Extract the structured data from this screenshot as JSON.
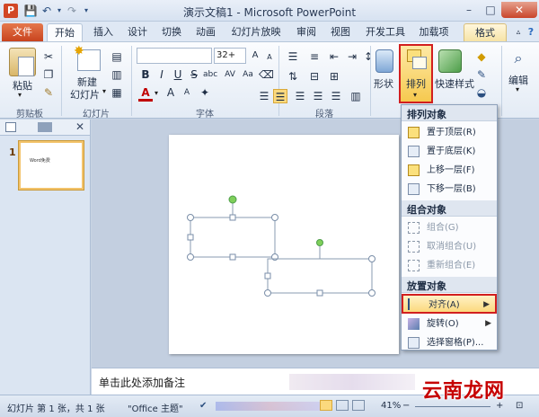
{
  "window": {
    "title": "演示文稿1 - Microsoft PowerPoint",
    "app_icon_letter": "P"
  },
  "tabs": [
    {
      "label": "文件"
    },
    {
      "label": "开始"
    },
    {
      "label": "插入"
    },
    {
      "label": "设计"
    },
    {
      "label": "切换"
    },
    {
      "label": "动画"
    },
    {
      "label": "幻灯片放映"
    },
    {
      "label": "审阅"
    },
    {
      "label": "视图"
    },
    {
      "label": "开发工具"
    },
    {
      "label": "加载项"
    },
    {
      "label": "格式"
    }
  ],
  "ribbon": {
    "clipboard": {
      "paste_label": "粘贴",
      "group_label": "剪贴板"
    },
    "slides": {
      "new_slide_label": "新建",
      "new_slide_label2": "幻灯片",
      "group_label": "幻灯片"
    },
    "font": {
      "size_value": "32+",
      "group_label": "字体"
    },
    "paragraph": {
      "group_label": "段落"
    },
    "drawing": {
      "shape_label": "形状",
      "arrange_label": "排列",
      "quickstyle_label": "快速样式"
    },
    "editing": {
      "edit_label": "编辑"
    }
  },
  "left_pane": {
    "slide_number": "1",
    "thumb_text": "Word免费"
  },
  "notes": {
    "placeholder": "单击此处添加备注"
  },
  "status": {
    "slide_info": "幻灯片 第 1 张，共 1 张",
    "theme": "\"Office 主题\"",
    "zoom": "41%"
  },
  "watermark": "云南龙网",
  "arrange_menu": {
    "section_order": "排列对象",
    "items_order": [
      {
        "label": "置于顶层(R)"
      },
      {
        "label": "置于底层(K)"
      },
      {
        "label": "上移一层(F)"
      },
      {
        "label": "下移一层(B)"
      }
    ],
    "section_group": "组合对象",
    "items_group": [
      {
        "label": "组合(G)"
      },
      {
        "label": "取消组合(U)"
      },
      {
        "label": "重新组合(E)"
      }
    ],
    "section_position": "放置对象",
    "items_position": [
      {
        "label": "对齐(A)"
      },
      {
        "label": "旋转(O)"
      },
      {
        "label": "选择窗格(P)..."
      }
    ]
  }
}
